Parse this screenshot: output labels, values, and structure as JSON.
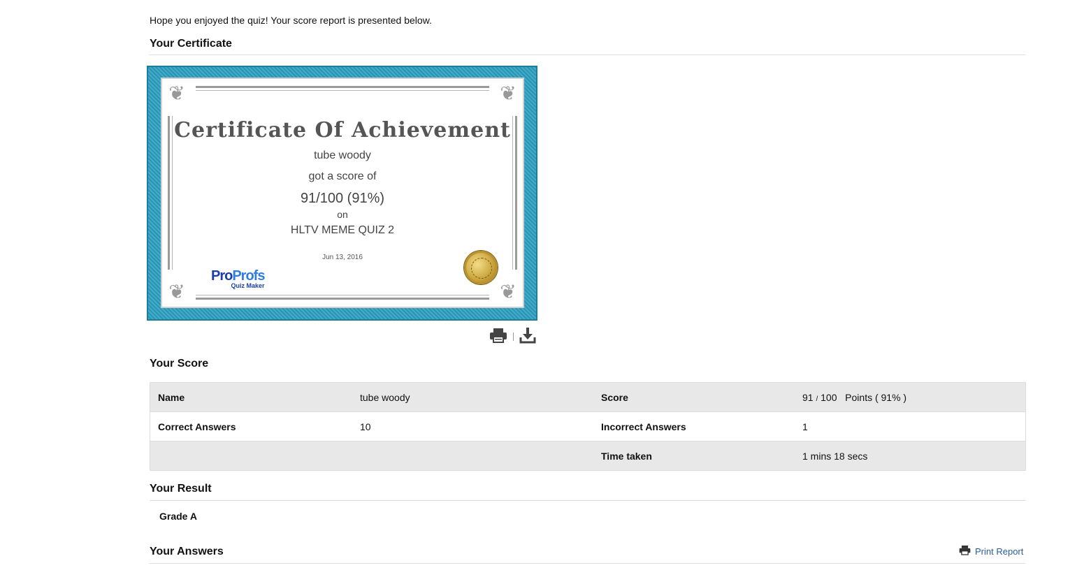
{
  "intro": "Hope you enjoyed the quiz! Your score report is presented below.",
  "sections": {
    "certificate": "Your Certificate",
    "score": "Your Score",
    "result": "Your Result",
    "answers": "Your Answers"
  },
  "certificate": {
    "title": "Certificate Of Achievement",
    "name": "tube woody",
    "got_score_of": "got a score of",
    "score": "91/100 (91%)",
    "on": "on",
    "quiz_name": "HLTV MEME QUIZ 2",
    "date": "Jun 13, 2016",
    "logo_pro": "Pro",
    "logo_profs": "Profs",
    "logo_sub": "Quiz Maker"
  },
  "score_table": {
    "rows": [
      {
        "k1": "Name",
        "v1": "tube woody",
        "k2": "Score",
        "v2_num": "91",
        "v2_slash": "/",
        "v2_den": "100",
        "v2_tail": "Points ( 91% )"
      },
      {
        "k1": "Correct Answers",
        "v1": "10",
        "k2": "Incorrect Answers",
        "v2": "1"
      },
      {
        "k1": "",
        "v1": "",
        "k2": "Time taken",
        "v2": "1 mins 18 secs"
      }
    ]
  },
  "result": {
    "grade": "Grade A"
  },
  "actions": {
    "print_report": "Print Report"
  },
  "icons": {
    "print": "printer-icon",
    "download": "download-icon"
  }
}
